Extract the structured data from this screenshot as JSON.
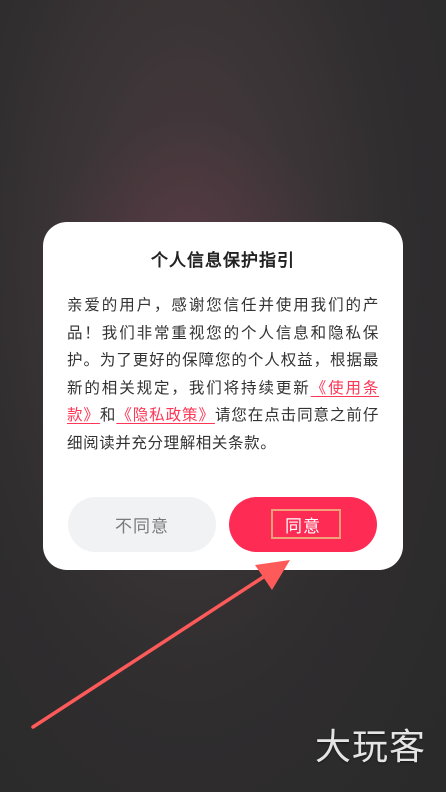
{
  "dialog": {
    "title": "个人信息保护指引",
    "body": {
      "intro": "亲爱的用户，感谢您信任并使用我们的产品！我们非常重视您的个人信息和隐私保护。为了更好的保障您的个人权益，根据最新的相关规定，我们将持续更新",
      "terms_link": "《使用条款》",
      "conjunction": "和",
      "privacy_link": "《隐私政策》",
      "outro": "请您在点击同意之前仔细阅读并充分理解相关条款。"
    },
    "buttons": {
      "disagree_label": "不同意",
      "agree_label": "同意"
    }
  },
  "watermark": {
    "text": "大玩客"
  },
  "colors": {
    "accent": "#fe2c55",
    "link": "#ff3656",
    "arrow": "#ff5a5a"
  }
}
